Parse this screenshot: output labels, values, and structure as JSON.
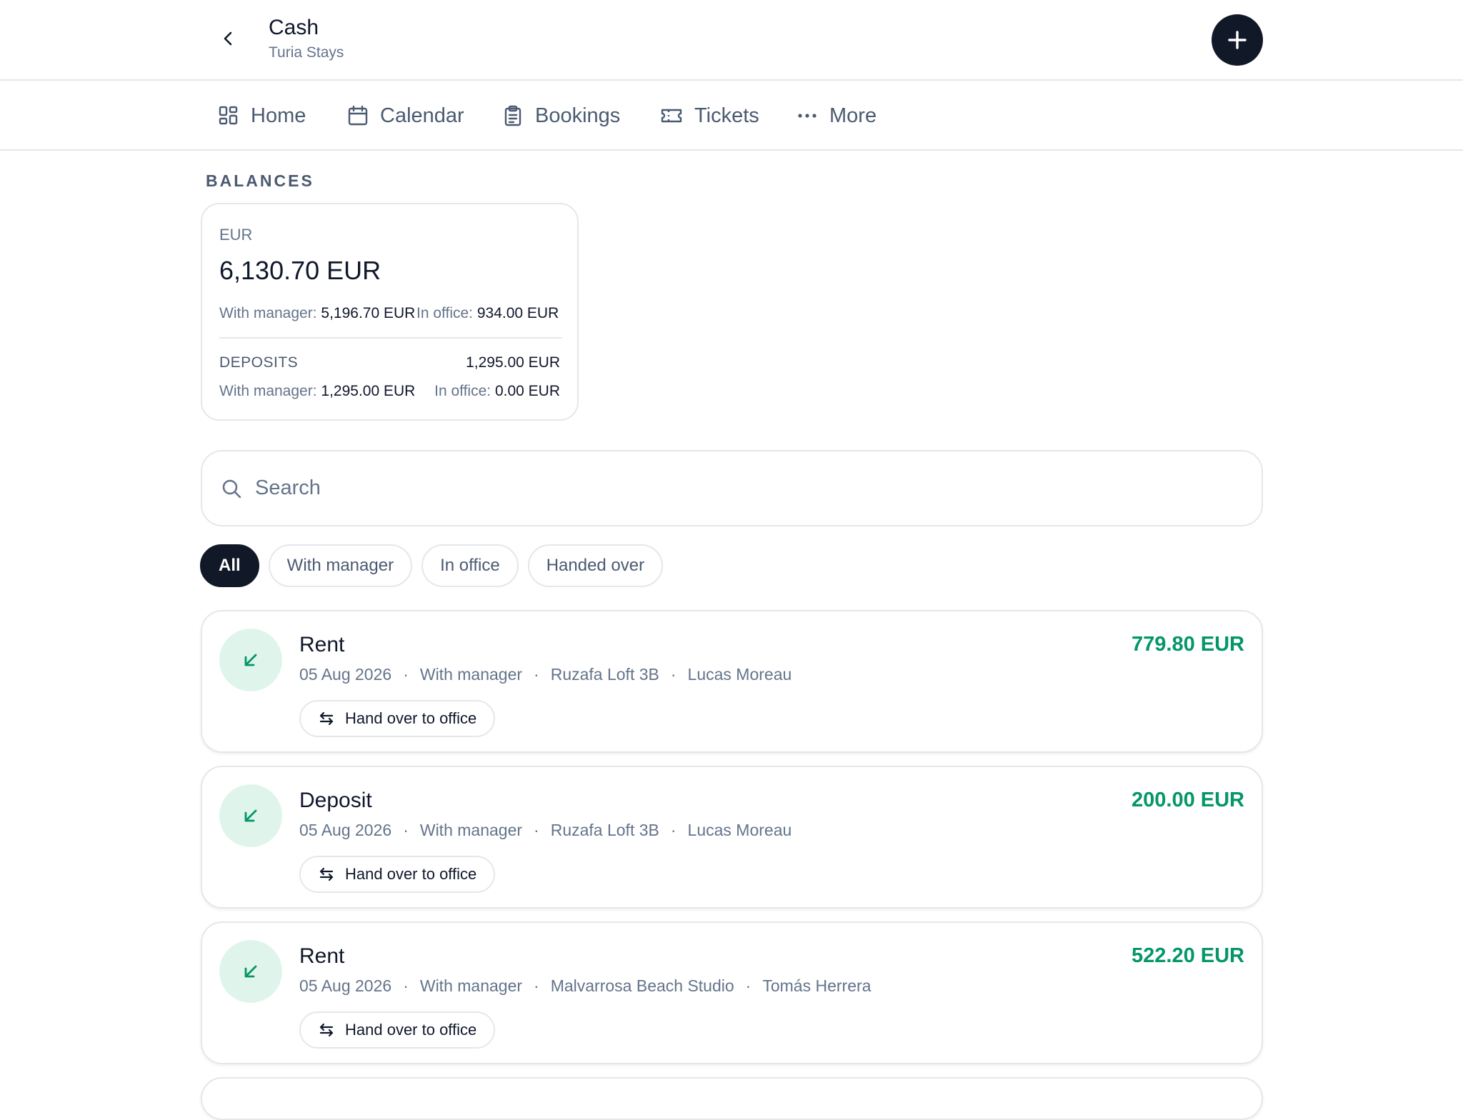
{
  "header": {
    "title": "Cash",
    "subtitle": "Turia Stays",
    "back_icon": "chevron-left-icon",
    "add_icon": "plus-icon"
  },
  "nav": {
    "items": [
      {
        "label": "Home",
        "icon": "grid-icon"
      },
      {
        "label": "Calendar",
        "icon": "calendar-icon"
      },
      {
        "label": "Bookings",
        "icon": "clipboard-icon"
      },
      {
        "label": "Tickets",
        "icon": "ticket-icon"
      },
      {
        "label": "More",
        "icon": "more-horizontal-icon"
      }
    ]
  },
  "balances": {
    "section_label": "BALANCES",
    "currency": "EUR",
    "total": "6,130.70 EUR",
    "with_manager_label": "With manager:",
    "with_manager_value": "5,196.70 EUR",
    "in_office_label": "In office:",
    "in_office_value": "934.00 EUR",
    "deposits_label": "DEPOSITS",
    "deposits_total": "1,295.00 EUR",
    "deposits_with_manager_label": "With manager:",
    "deposits_with_manager_value": "1,295.00 EUR",
    "deposits_in_office_label": "In office:",
    "deposits_in_office_value": "0.00 EUR"
  },
  "search": {
    "placeholder": "Search"
  },
  "filters": {
    "chips": [
      "All",
      "With manager",
      "In office",
      "Handed over"
    ],
    "selected": "All"
  },
  "transactions": [
    {
      "title": "Rent",
      "date": "05 Aug 2026",
      "status": "With manager",
      "property": "Ruzafa Loft 3B",
      "guest": "Lucas Moreau",
      "amount": "779.80 EUR",
      "action": "Hand over to office"
    },
    {
      "title": "Deposit",
      "date": "05 Aug 2026",
      "status": "With manager",
      "property": "Ruzafa Loft 3B",
      "guest": "Lucas Moreau",
      "amount": "200.00 EUR",
      "action": "Hand over to office"
    },
    {
      "title": "Rent",
      "date": "05 Aug 2026",
      "status": "With manager",
      "property": "Malvarrosa Beach Studio",
      "guest": "Tomás Herrera",
      "amount": "522.20 EUR",
      "action": "Hand over to office"
    }
  ],
  "colors": {
    "accent_dark": "#111827",
    "amount_green": "#059669",
    "icon_bg": "#dff5ec",
    "muted_text": "#64748b",
    "border": "#e5e7eb"
  },
  "meta_separator": "·"
}
